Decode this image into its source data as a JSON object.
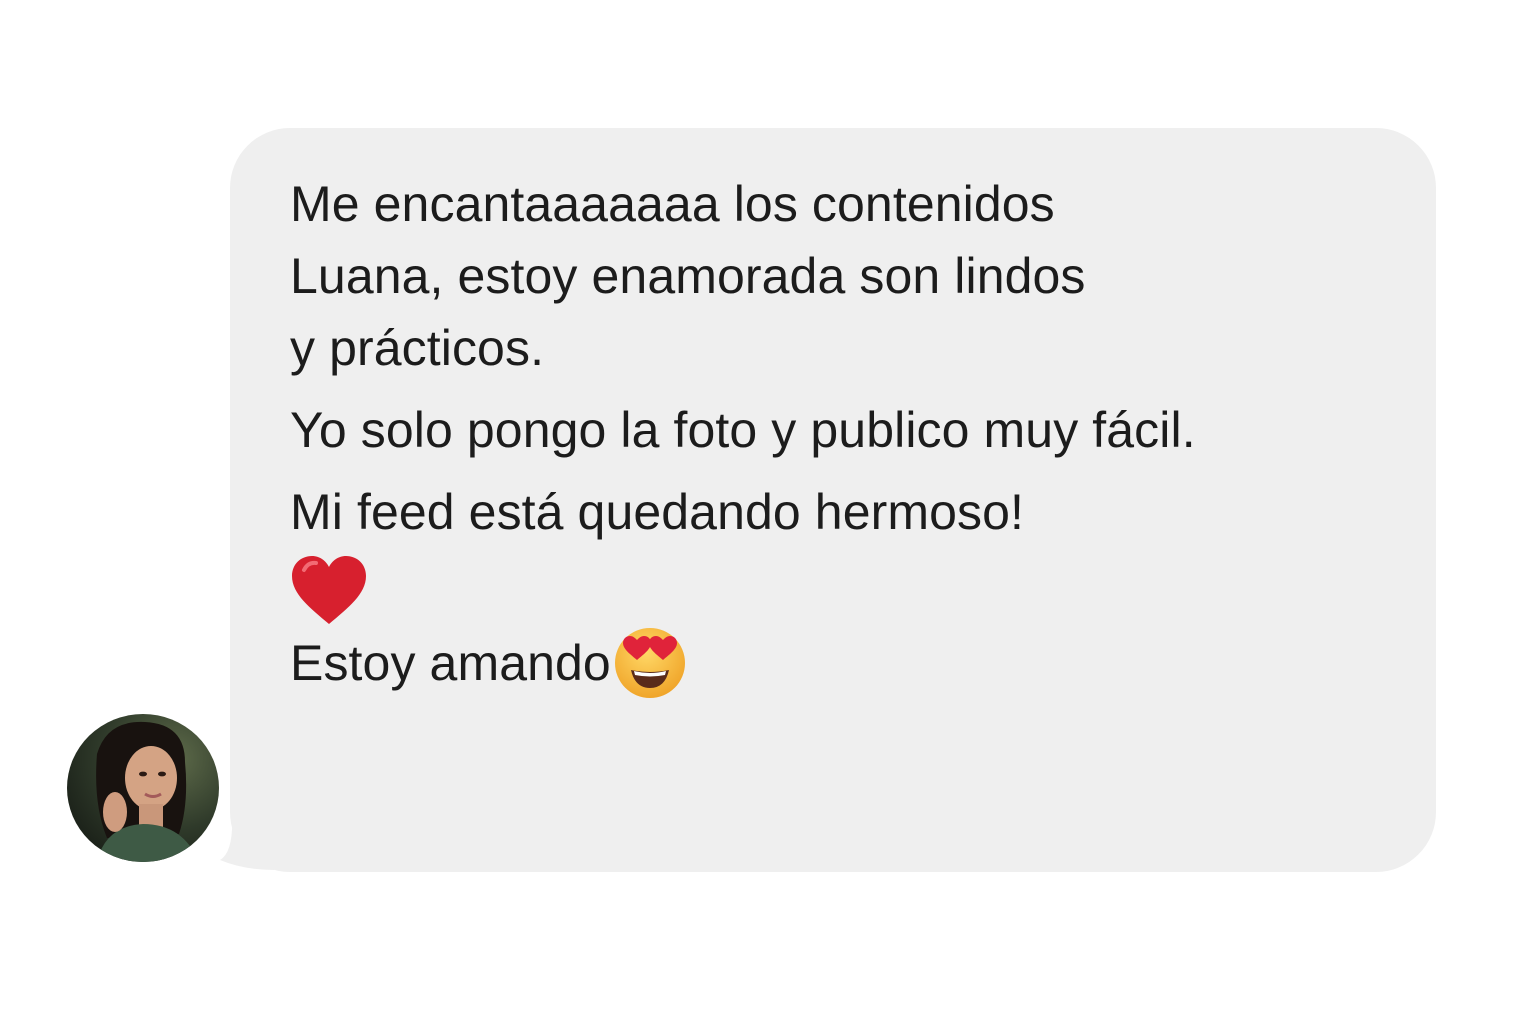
{
  "message": {
    "paragraph1": [
      "Me encantaaaaaaa los contenidos",
      "Luana, estoy enamorada son lindos",
      "y prácticos."
    ],
    "paragraph2": "Yo solo pongo la foto y publico muy fácil.",
    "paragraph3": "Mi feed está quedando hermoso!",
    "heart_emoji": "red-heart-icon",
    "last_line_text": "Estoy amando",
    "last_line_emoji": "heart-eyes-face-icon"
  },
  "colors": {
    "bubble": "#efefef",
    "text": "#1c1c1c",
    "heart": "#d7202e",
    "emoji_face": "#f7b733"
  }
}
